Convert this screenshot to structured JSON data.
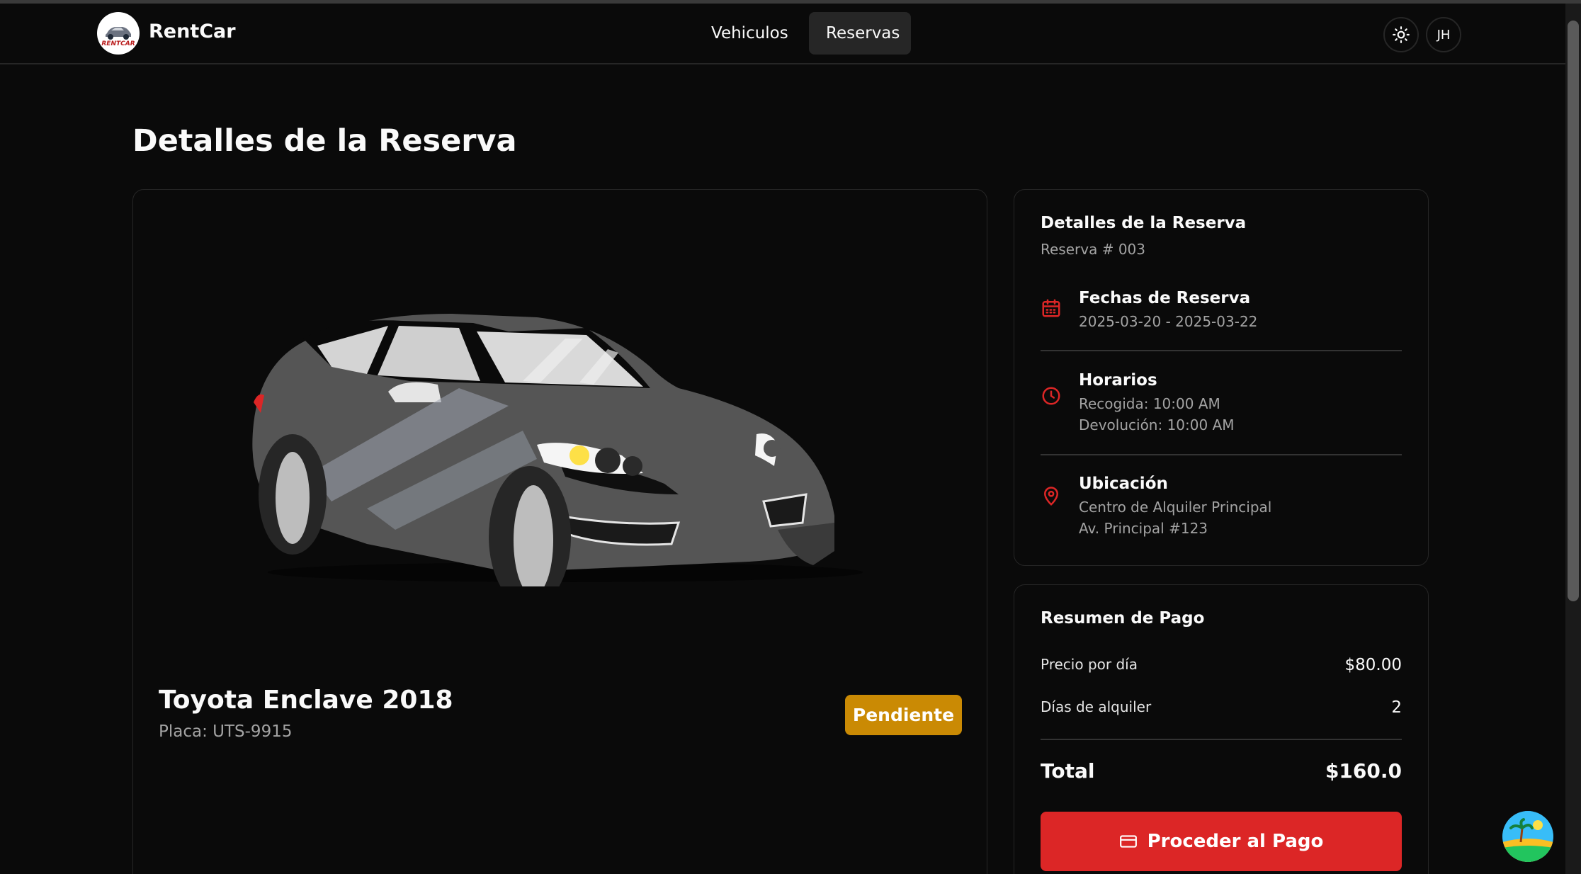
{
  "brand": {
    "name": "RentCar",
    "logo_text": "RENTCAR"
  },
  "nav": {
    "items": [
      {
        "label": "Vehiculos"
      },
      {
        "label": "Reservas"
      }
    ],
    "active": "Reservas"
  },
  "header": {
    "theme_icon": "sun-icon",
    "avatar_initials": "JH"
  },
  "page": {
    "title": "Detalles de la Reserva"
  },
  "vehicle": {
    "name": "Toyota Enclave 2018",
    "plate": "Placa: UTS-9915",
    "status": "Pendiente",
    "status_color": "#ca8a04"
  },
  "details": {
    "title": "Detalles de la Reserva",
    "reservation_number": "Reserva # 003",
    "dates": {
      "icon": "calendar-icon",
      "title": "Fechas de Reserva",
      "value": "2025-03-20 - 2025-03-22"
    },
    "schedule": {
      "icon": "clock-icon",
      "title": "Horarios",
      "pickup": "Recogida: 10:00 AM",
      "return": "Devolución: 10:00 AM"
    },
    "location": {
      "icon": "map-pin-icon",
      "title": "Ubicación",
      "name": "Centro de Alquiler Principal",
      "address": "Av. Principal #123"
    }
  },
  "payment": {
    "title": "Resumen de Pago",
    "price_per_day_label": "Precio por día",
    "price_per_day_value": "$80.00",
    "days_label": "Días de alquiler",
    "days_value": "2",
    "total_label": "Total",
    "total_value": "$160.0",
    "button_label": "Proceder al Pago",
    "button_icon": "credit-card-icon"
  },
  "colors": {
    "accent": "#dc2626",
    "background": "#0a0a0a",
    "border": "#262626",
    "muted": "#a3a3a3"
  }
}
